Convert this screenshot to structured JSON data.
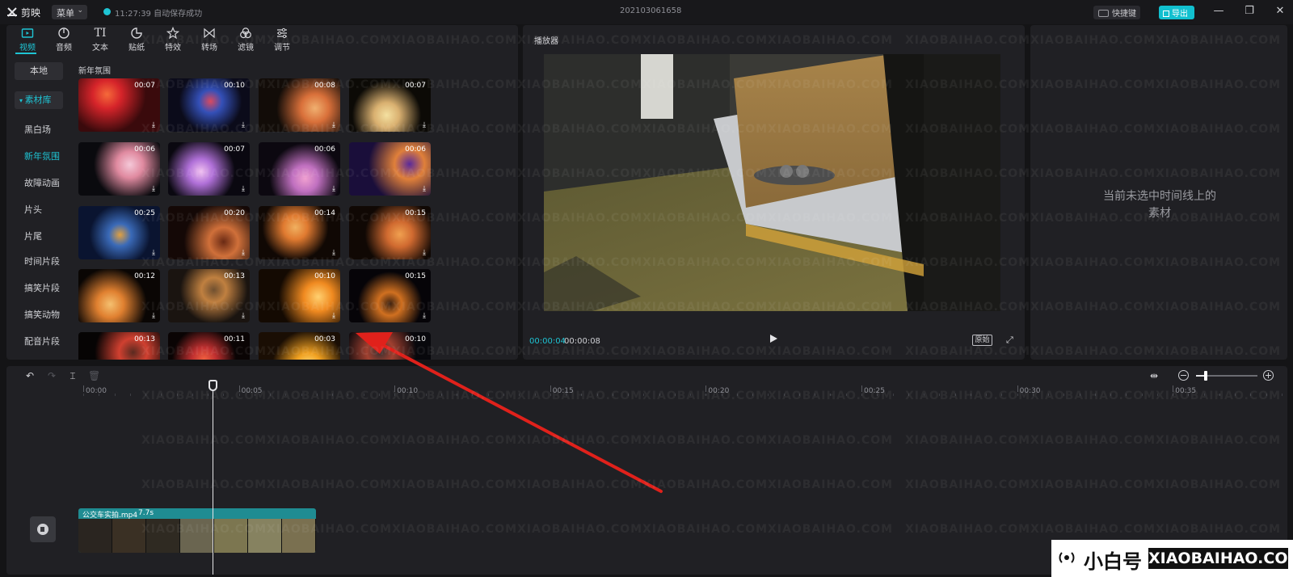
{
  "app": {
    "name": "剪映",
    "menu_label": "菜单",
    "save_status": "11:27:39 自动保存成功",
    "project_name": "202103061658",
    "shortcut_label": "快捷键",
    "export_label": "导出",
    "accent_color": "#1ec4d4"
  },
  "media_tabs": [
    {
      "label": "视频",
      "icon": "video-icon",
      "active": true
    },
    {
      "label": "音频",
      "icon": "audio-icon"
    },
    {
      "label": "文本",
      "icon": "text-icon"
    },
    {
      "label": "贴纸",
      "icon": "sticker-icon"
    },
    {
      "label": "特效",
      "icon": "effects-icon"
    },
    {
      "label": "转场",
      "icon": "transition-icon"
    },
    {
      "label": "滤镜",
      "icon": "filter-icon"
    },
    {
      "label": "调节",
      "icon": "adjust-icon"
    }
  ],
  "sidebar": {
    "local_label": "本地",
    "library_label": "素材库",
    "categories": [
      "黑白场",
      "新年氛围",
      "故障动画",
      "片头",
      "片尾",
      "时间片段",
      "搞笑片段",
      "搞笑动物",
      "配音片段"
    ],
    "active_category": "新年氛围"
  },
  "grid": {
    "heading": "新年氛围",
    "items": [
      {
        "duration": "00:07"
      },
      {
        "duration": "00:10"
      },
      {
        "duration": "00:08"
      },
      {
        "duration": "00:07"
      },
      {
        "duration": "00:06"
      },
      {
        "duration": "00:07"
      },
      {
        "duration": "00:06"
      },
      {
        "duration": "00:06"
      },
      {
        "duration": "00:25"
      },
      {
        "duration": "00:20"
      },
      {
        "duration": "00:14"
      },
      {
        "duration": "00:15"
      },
      {
        "duration": "00:12"
      },
      {
        "duration": "00:13"
      },
      {
        "duration": "00:10"
      },
      {
        "duration": "00:15"
      },
      {
        "duration": "00:13"
      },
      {
        "duration": "00:11"
      },
      {
        "duration": "00:03"
      },
      {
        "duration": "00:10"
      }
    ]
  },
  "player": {
    "title": "播放器",
    "current_time": "00:00:04",
    "total_time": "00:00:08",
    "ratio_label": "原始"
  },
  "properties": {
    "empty_text": "当前未选中时间线上的素材"
  },
  "timeline": {
    "ruler": [
      "00:00",
      "00:05",
      "00:10",
      "00:15",
      "00:20",
      "00:25",
      "00:30",
      "00:35"
    ],
    "clip_name": "公交车实拍.mp4",
    "clip_duration": "7.7s"
  },
  "watermark": {
    "cn": "小白号",
    "en": "XIAOBAIHAO.COM"
  }
}
